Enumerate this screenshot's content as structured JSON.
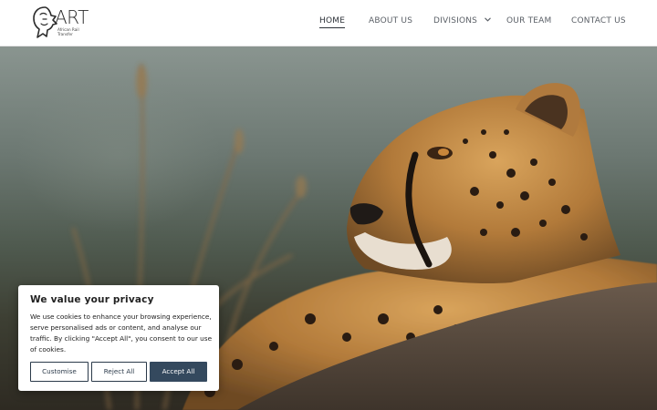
{
  "logo": {
    "wordmark": "ART",
    "tagline": "African Rail Transfer"
  },
  "nav": {
    "items": [
      {
        "label": "HOME",
        "active": true
      },
      {
        "label": "ABOUT US"
      },
      {
        "label": "DIVISIONS",
        "has_dropdown": true
      },
      {
        "label": "OUR TEAM"
      },
      {
        "label": "CONTACT US"
      }
    ]
  },
  "hero": {
    "subject": "cheetah resting on a rock"
  },
  "cookie": {
    "title": "We value your privacy",
    "body": "We use cookies to enhance your browsing experience, serve personalised ads or content, and analyse our traffic. By clicking \"Accept All\", you consent to our use of cookies.",
    "customise_label": "Customise",
    "reject_label": "Reject All",
    "accept_label": "Accept All"
  },
  "colors": {
    "nav_text": "#5a5f66",
    "nav_active": "#2c3138",
    "button_dark": "#34495e"
  }
}
